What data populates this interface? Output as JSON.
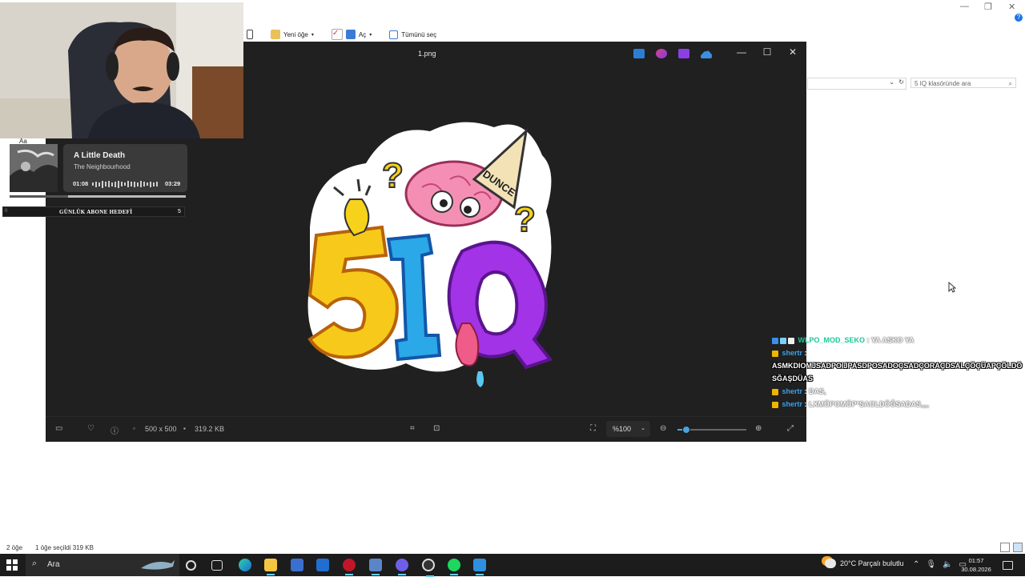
{
  "explorer": {
    "ribbon": [
      {
        "label": "Yeni öğe",
        "has_dropdown": true,
        "icon": "new-item-icon"
      },
      {
        "label": "Aç",
        "has_dropdown": true,
        "icon": "open-icon"
      },
      {
        "label": "Tümünü seç",
        "has_dropdown": false,
        "icon": "select-all-icon"
      }
    ],
    "search_placeholder": "5 IQ klasöründe ara",
    "status": {
      "items": "2 öğe",
      "selected": "1 öğe seçildi  319 KB"
    }
  },
  "viewer": {
    "title": "1.png",
    "dimensions": "500 x 500",
    "file_size": "319.2 KB",
    "zoom": "%100",
    "zoom_fraction": 0.12,
    "image_text": {
      "number": "5IQ",
      "hat": "DUNCE"
    }
  },
  "music": {
    "title": "A Little Death",
    "artist": "The Neighbourhood",
    "current": "01:08",
    "total": "03:29",
    "progress": 0.33,
    "mini_label": "Aa"
  },
  "goal": {
    "label": "GÜNLÜK ABONE HEDEFİ",
    "left_value": "0",
    "target": "5"
  },
  "chat": [
    {
      "user": "WLPO_MOD_SEKO",
      "message": ": YA ASKO YA",
      "mod": true
    },
    {
      "user": "shertr",
      "message": ":",
      "mod": false
    },
    {
      "user": "",
      "message": "ASMKDIOMJSADPOIJPASDPOSADOÇSADÇORAÇDSALÇÖÇÜAPÇÖLDÖ",
      "mod": false
    },
    {
      "user": "",
      "message": "SĞAŞDÜAS",
      "mod": false
    },
    {
      "user": "shertr",
      "message": ": DAS,",
      "mod": false
    },
    {
      "user": "shertr",
      "message": ": LXMÖPOMÖP*SAOLDÖĞSADAS,,,,",
      "mod": false
    }
  ],
  "taskbar": {
    "search": "Ara",
    "weather": "20°C  Parçalı bulutlu",
    "time": "01:57",
    "date": "30.08.2026"
  }
}
